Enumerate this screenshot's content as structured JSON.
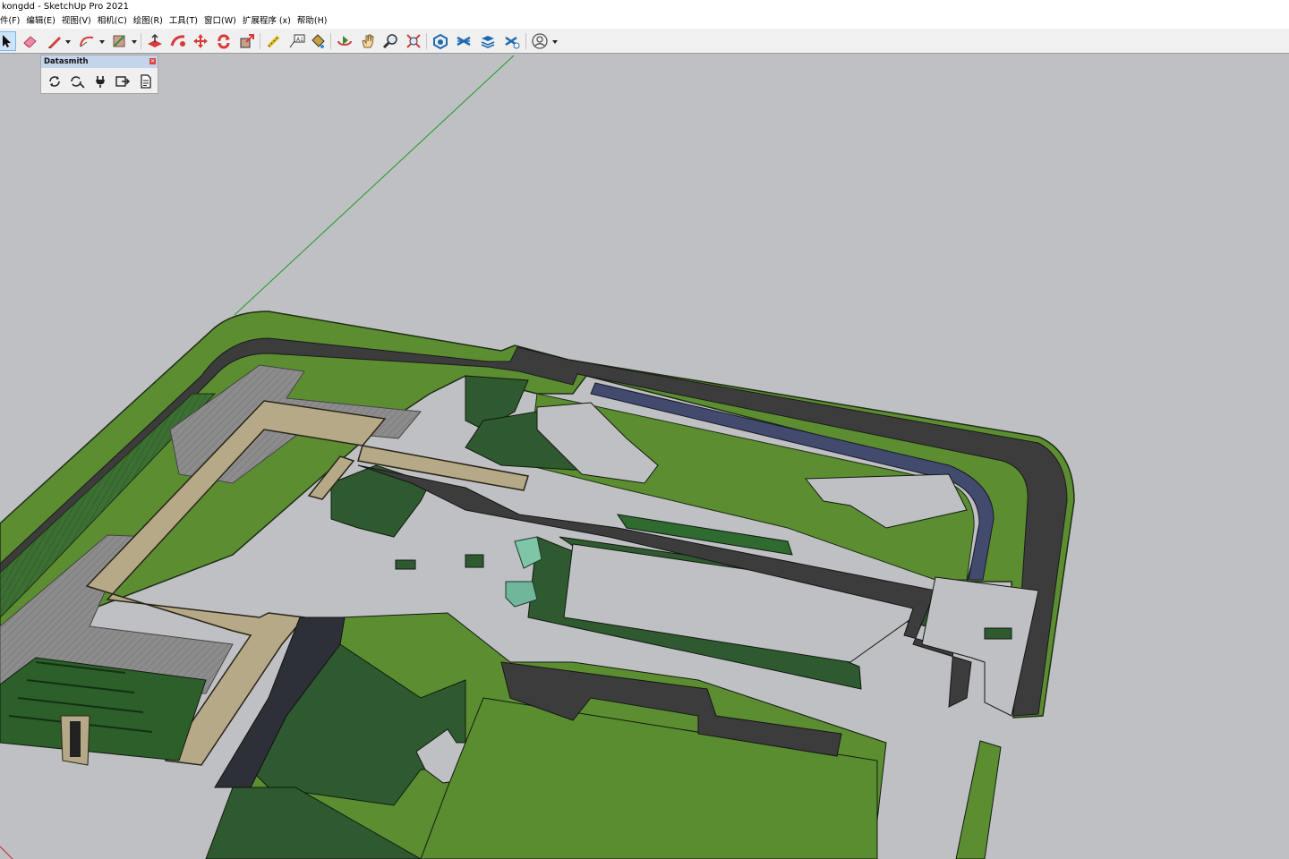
{
  "app": {
    "title": "kongdd - SketchUp Pro 2021"
  },
  "menu": [
    "件(F)",
    "编辑(E)",
    "视图(V)",
    "相机(C)",
    "绘图(R)",
    "工具(T)",
    "窗口(W)",
    "扩展程序 (x)",
    "帮助(H)"
  ],
  "toolbar": {
    "tools": [
      "select",
      "eraser",
      "line",
      "arc",
      "rectangle",
      "push-pull",
      "follow-me",
      "move",
      "rotate",
      "scale",
      "tape-measure",
      "text",
      "paint-bucket",
      "orbit",
      "pan",
      "zoom",
      "zoom-extents",
      "warehouse",
      "extension-warehouse",
      "layout",
      "extension-manager",
      "profile"
    ]
  },
  "datasmith": {
    "title": "Datasmith",
    "tools": [
      "sync",
      "sync-settings",
      "direct-link",
      "export",
      "export-log"
    ]
  },
  "colors": {
    "background": "#bfc0c4",
    "grass": "#5c8e31",
    "dark_grass": "#2f5a2f",
    "road": "#3c3c3c",
    "walkway": "#b5a987",
    "paving": "#8e8e8e",
    "water": "#424a6e",
    "axis_green": "#1f9a1f",
    "axis_red": "#cc2222"
  }
}
